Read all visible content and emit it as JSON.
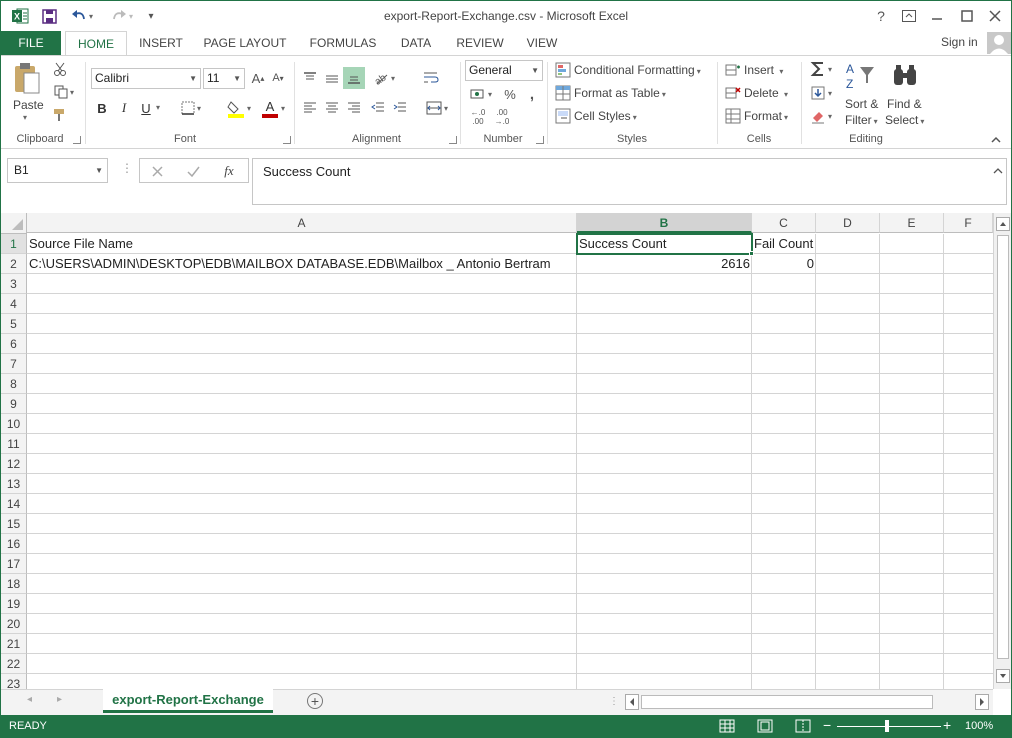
{
  "window": {
    "title": "export-Report-Exchange.csv - Microsoft Excel",
    "help": "?",
    "sign_in": "Sign in"
  },
  "ribbon_tabs": [
    "FILE",
    "HOME",
    "INSERT",
    "PAGE LAYOUT",
    "FORMULAS",
    "DATA",
    "REVIEW",
    "VIEW"
  ],
  "ribbon": {
    "clipboard": {
      "paste": "Paste",
      "label": "Clipboard"
    },
    "font": {
      "name": "Calibri",
      "size": "11",
      "bold": "B",
      "italic": "I",
      "underline": "U",
      "label": "Font"
    },
    "alignment": {
      "label": "Alignment"
    },
    "number": {
      "format": "General",
      "percent": "%",
      "label": "Number"
    },
    "styles": {
      "conditional": "Conditional Formatting",
      "format_table": "Format as Table",
      "cell_styles": "Cell Styles",
      "label": "Styles"
    },
    "cells": {
      "insert": "Insert",
      "delete": "Delete",
      "format": "Format",
      "label": "Cells"
    },
    "editing": {
      "sort_1": "Sort &",
      "sort_2": "Filter",
      "find_1": "Find &",
      "find_2": "Select",
      "label": "Editing"
    }
  },
  "formula_bar": {
    "name_box": "B1",
    "fx": "fx",
    "content": "Success Count"
  },
  "columns": [
    "A",
    "B",
    "C",
    "D",
    "E",
    "F"
  ],
  "rows": [
    "1",
    "2",
    "3",
    "4",
    "5",
    "6",
    "7",
    "8",
    "9",
    "10",
    "11",
    "12",
    "13",
    "14",
    "15",
    "16",
    "17",
    "18",
    "19",
    "20",
    "21",
    "22",
    "23"
  ],
  "cells": {
    "A1": "Source File Name",
    "B1": "Success Count",
    "C1": "Fail Count",
    "A2": "C:\\USERS\\ADMIN\\DESKTOP\\EDB\\MAILBOX DATABASE.EDB\\Mailbox _ Antonio Bertram",
    "B2": "2616",
    "C2": "0"
  },
  "sheet": {
    "name": "export-Report-Exchange"
  },
  "status": {
    "ready": "READY",
    "zoom": "100%"
  },
  "colors": {
    "accent": "#217346",
    "grid": "#d4d4d4",
    "header": "#f3f3f3"
  }
}
